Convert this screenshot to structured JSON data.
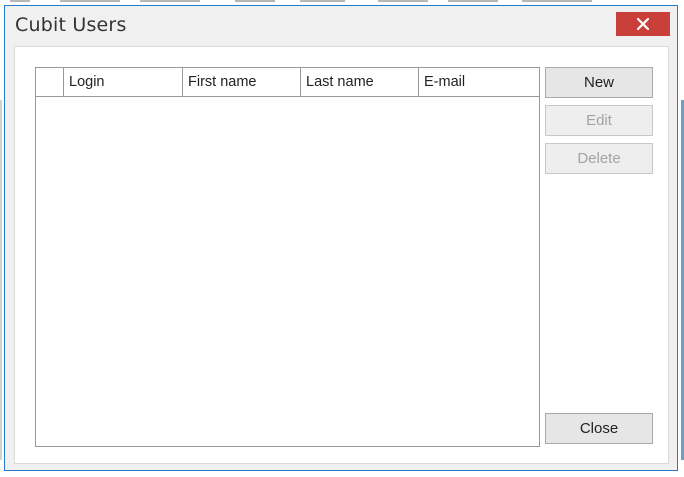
{
  "window": {
    "title": "Cubit  Users"
  },
  "grid": {
    "columns": [
      "",
      "Login",
      "First name",
      "Last name",
      "E-mail"
    ],
    "rows": []
  },
  "buttons": {
    "new": "New",
    "edit": "Edit",
    "delete": "Delete",
    "close": "Close"
  },
  "colors": {
    "accent_border": "#2b7bc7",
    "close_button": "#c9403a",
    "disabled_text": "#a3a3a3"
  }
}
